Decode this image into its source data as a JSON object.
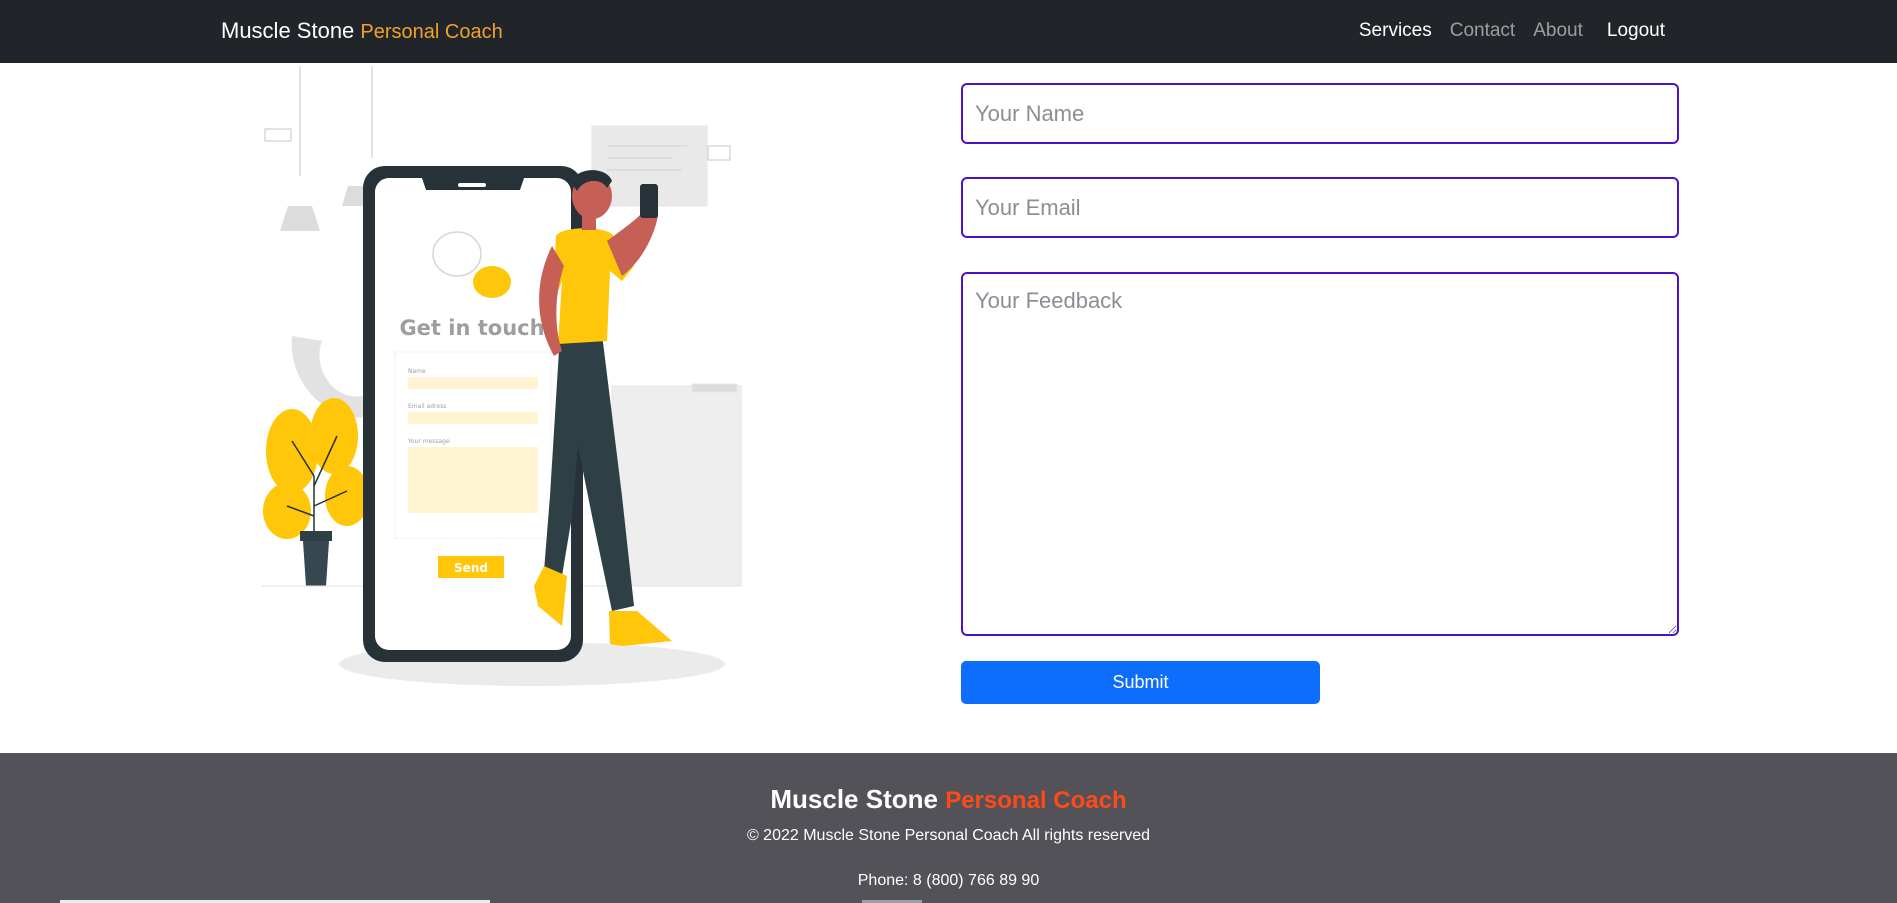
{
  "navbar": {
    "brand_main": "Muscle Stone",
    "brand_accent": "Personal Coach",
    "links": {
      "services": "Services",
      "contact": "Contact",
      "about": "About",
      "logout": "Logout"
    }
  },
  "illustration": {
    "heading": "Get in touch",
    "name_label": "Name",
    "email_label": "Email adress",
    "message_label": "Your message",
    "send_label": "Send"
  },
  "form": {
    "name_placeholder": "Your Name",
    "email_placeholder": "Your Email",
    "feedback_placeholder": "Your Feedback",
    "submit_label": "Submit"
  },
  "footer": {
    "brand_main": "Muscle Stone",
    "brand_accent": "Personal Coach",
    "copyright": "© 2022 Muscle Stone Personal Coach All rights reserved",
    "phone": "Phone: 8 (800) 766 89 90"
  },
  "colors": {
    "navbar_bg": "#212529",
    "brand_accent": "#f0a12b",
    "field_border": "#4b12c9",
    "submit_bg": "#0d6efd",
    "footer_bg": "#535258",
    "footer_accent": "#ff4a17",
    "illustration_yellow": "#ffc60a"
  }
}
